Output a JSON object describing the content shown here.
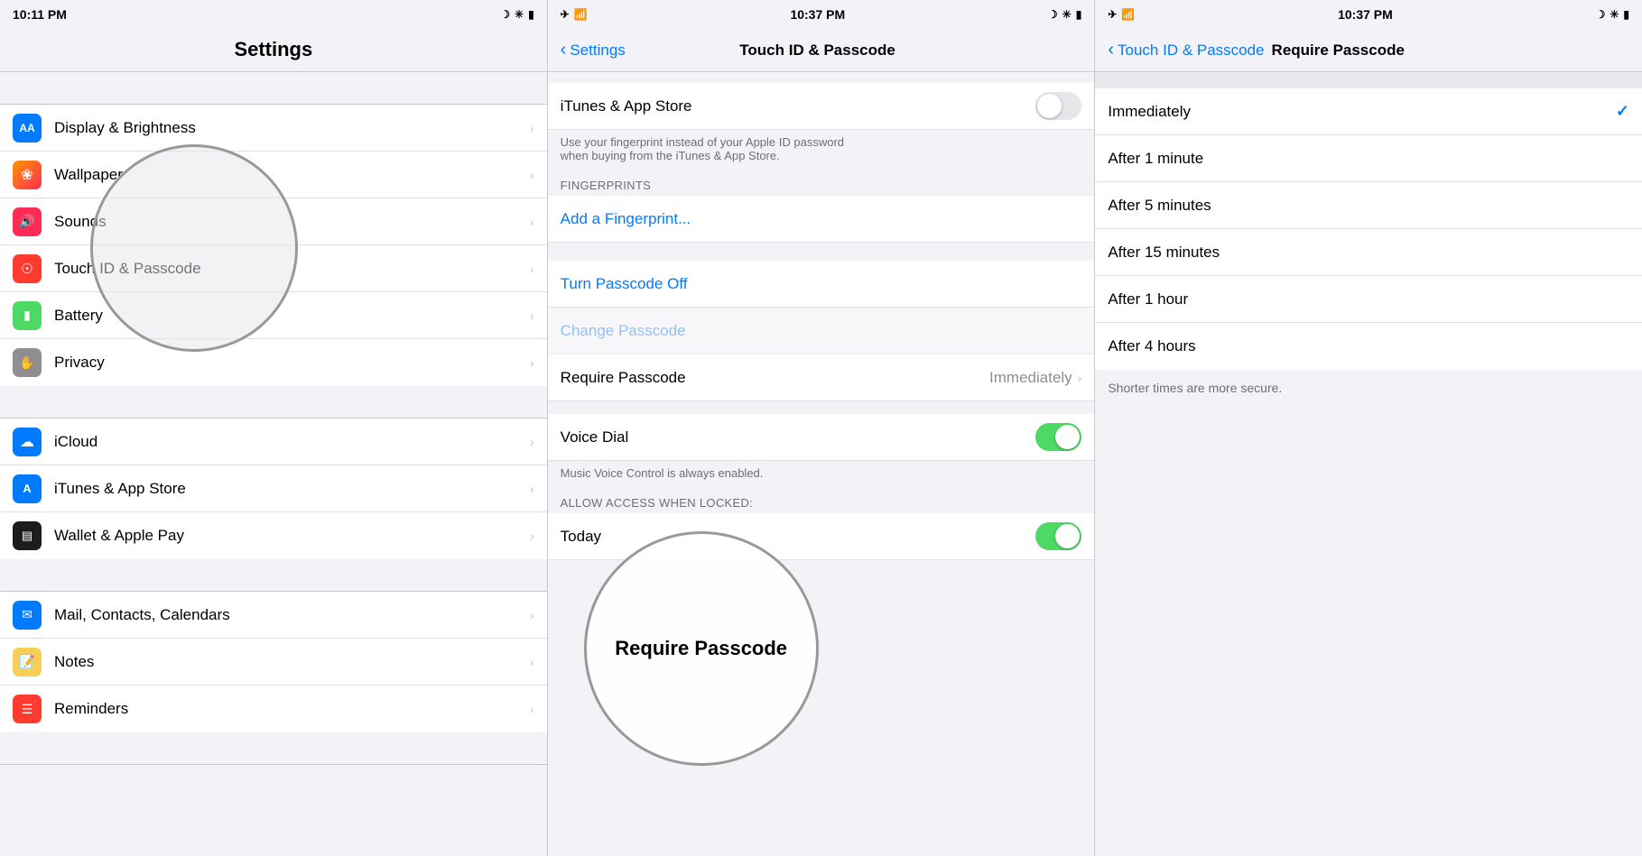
{
  "panel1": {
    "status": {
      "time": "10:11 PM",
      "left_icons": "wifi signal",
      "right_icons": "moon bluetooth battery"
    },
    "nav_title": "Settings",
    "items_group1": [
      {
        "id": "display",
        "label": "Display & Brightness",
        "icon_bg": "#007aff",
        "icon": "AA"
      },
      {
        "id": "wallpaper",
        "label": "Wallpaper",
        "icon_bg": "#ff2d55",
        "icon": "❀"
      },
      {
        "id": "sounds",
        "label": "Sounds",
        "icon_bg": "#ff2d55",
        "icon": "🔊"
      },
      {
        "id": "touchid",
        "label": "Touch ID & Passcode",
        "icon_bg": "#ff3b30",
        "icon": "👆"
      },
      {
        "id": "battery",
        "label": "Battery",
        "icon_bg": "#4cd964",
        "icon": "🔋"
      },
      {
        "id": "privacy",
        "label": "Privacy",
        "icon_bg": "#8e8e93",
        "icon": "✋"
      }
    ],
    "items_group2": [
      {
        "id": "icloud",
        "label": "iCloud",
        "icon_bg": "#007aff",
        "icon": "☁"
      },
      {
        "id": "itunes",
        "label": "iTunes & App Store",
        "icon_bg": "#007aff",
        "icon": "A"
      },
      {
        "id": "wallet",
        "label": "Wallet & Apple Pay",
        "icon_bg": "#333",
        "icon": "▤"
      }
    ],
    "items_group3": [
      {
        "id": "mail",
        "label": "Mail, Contacts, Calendars",
        "icon_bg": "#007aff",
        "icon": "✉"
      },
      {
        "id": "notes",
        "label": "Notes",
        "icon_bg": "#f7cf54",
        "icon": "📝"
      },
      {
        "id": "reminders",
        "label": "Reminders",
        "icon_bg": "#ff3b30",
        "icon": "☰"
      }
    ]
  },
  "panel2": {
    "status": {
      "time": "10:37 PM",
      "left_icons": "airplane wifi",
      "right_icons": "moon bluetooth battery"
    },
    "nav_back": "Settings",
    "nav_title": "Touch ID & Passcode",
    "itunes_toggle_label": "iTunes & App Store",
    "itunes_toggle_state": false,
    "itunes_footer": "Use your fingerprint instead of your Apple ID password\nwhen buying from the iTunes & App Store.",
    "fingerprints_header": "FINGERPRINTS",
    "add_fingerprint": "Add a Fingerprint...",
    "turn_passcode_off": "Turn Passcode Off",
    "change_passcode_label": "Change Passcode",
    "require_passcode_label": "Require Passcode",
    "require_passcode_value": "Immediately",
    "voice_control_label": "Voice Dial",
    "voice_control_state": true,
    "voice_control_note": "Music Voice Control is always enabled.",
    "allow_when_locked_header": "ALLOW ACCESS WHEN LOCKED:",
    "today_label": "Today",
    "today_state": true,
    "circle_text": "Require Passcode"
  },
  "panel3": {
    "status": {
      "time": "10:37 PM",
      "left_icons": "airplane wifi",
      "right_icons": "moon bluetooth battery"
    },
    "nav_back": "Touch ID & Passcode",
    "nav_title": "Require Passcode",
    "options": [
      {
        "id": "immediately",
        "label": "Immediately",
        "checked": true
      },
      {
        "id": "after1min",
        "label": "After 1 minute",
        "checked": false
      },
      {
        "id": "after5min",
        "label": "After 5 minutes",
        "checked": false
      },
      {
        "id": "after15min",
        "label": "After 15 minutes",
        "checked": false
      },
      {
        "id": "after1hr",
        "label": "After 1 hour",
        "checked": false
      },
      {
        "id": "after4hr",
        "label": "After 4 hours",
        "checked": false
      }
    ],
    "note": "Shorter times are more secure."
  },
  "icons": {
    "chevron": "›",
    "back_arrow": "‹",
    "checkmark": "✓"
  }
}
